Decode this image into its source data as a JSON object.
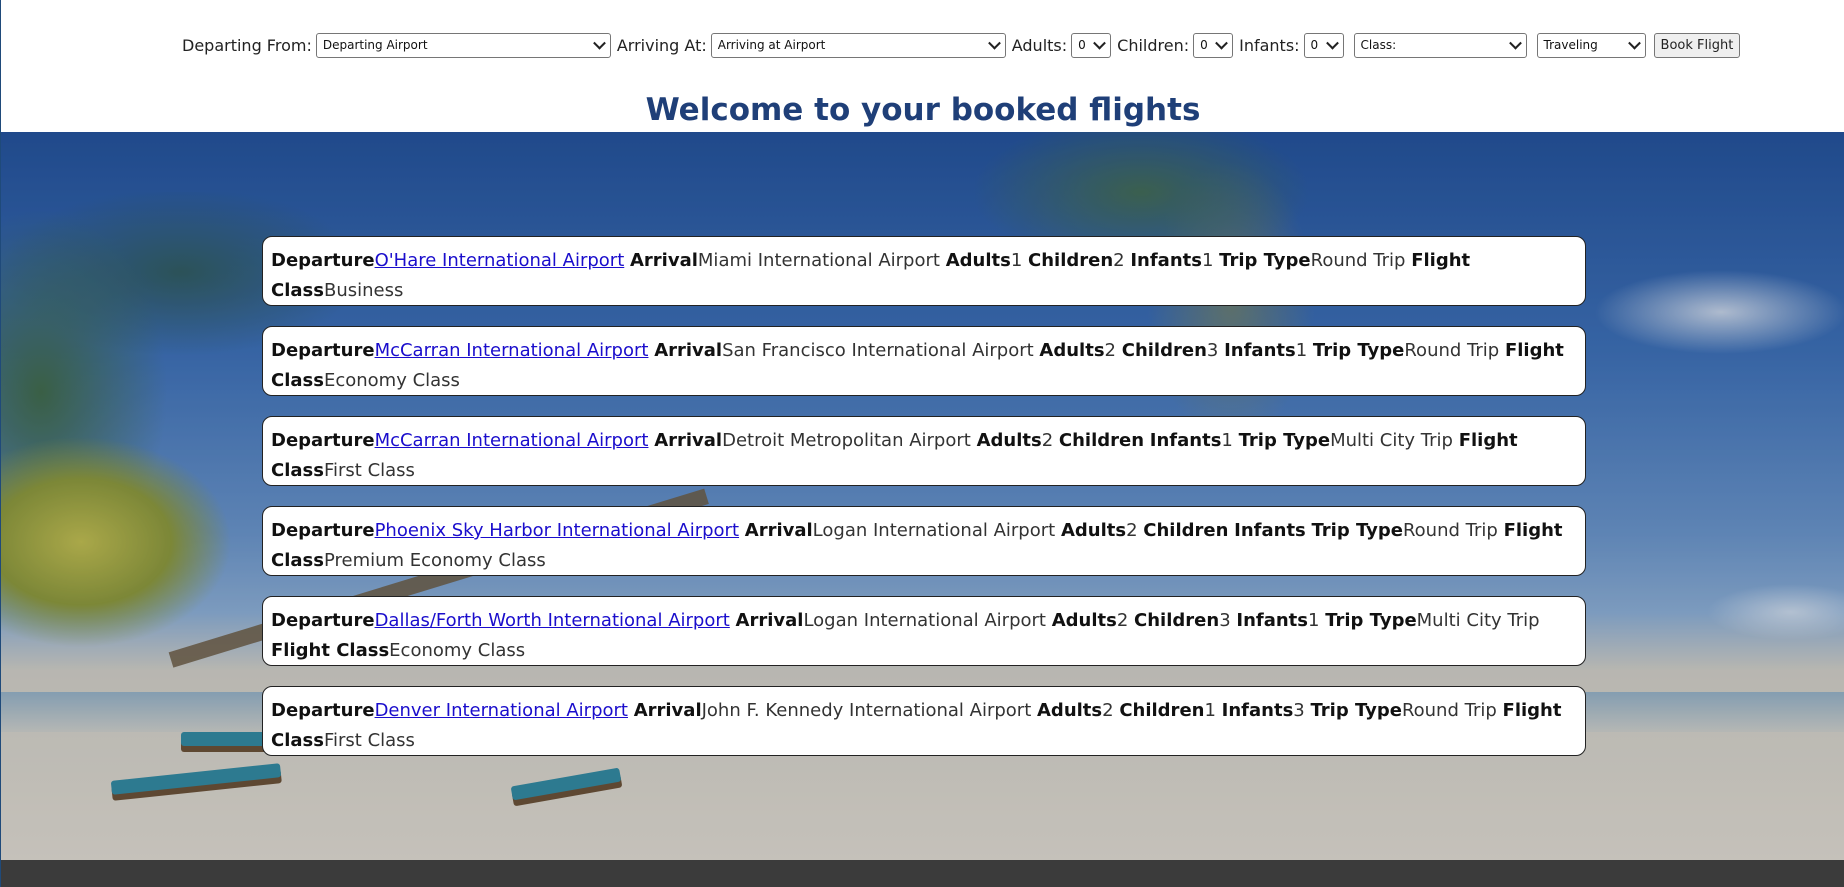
{
  "booking_bar": {
    "departing_label": "Departing From:",
    "departing_value": "Departing Airport",
    "arriving_label": "Arriving At:",
    "arriving_value": "Arriving at Airport",
    "adults_label": "Adults:",
    "adults_value": "0",
    "children_label": "Children:",
    "children_value": "0",
    "infants_label": "Infants:",
    "infants_value": "0",
    "class_value": "Class:",
    "traveling_value": "Traveling",
    "book_button": "Book Flight"
  },
  "page": {
    "heading": "Welcome to your booked flights"
  },
  "labels": {
    "departure": "Departure",
    "arrival": "Arrival",
    "adults": "Adults",
    "children": "Children",
    "infants": "Infants",
    "trip_type": "Trip Type",
    "flight_class": "Flight Class"
  },
  "flights": [
    {
      "departure": "O'Hare International Airport",
      "arrival": "Miami International Airport",
      "adults": "1",
      "children": "2",
      "infants": "1",
      "trip_type": "Round Trip",
      "flight_class": "Business"
    },
    {
      "departure": "McCarran International Airport",
      "arrival": "San Francisco International Airport",
      "adults": "2",
      "children": "3",
      "infants": "1",
      "trip_type": "Round Trip",
      "flight_class": "Economy Class"
    },
    {
      "departure": "McCarran International Airport",
      "arrival": "Detroit Metropolitan Airport",
      "adults": "2",
      "children": "",
      "infants": "1",
      "trip_type": "Multi City Trip",
      "flight_class": "First Class"
    },
    {
      "departure": "Phoenix Sky Harbor International Airport",
      "arrival": "Logan International Airport",
      "adults": "2",
      "children": "",
      "infants": "",
      "trip_type": "Round Trip",
      "flight_class": "Premium Economy Class"
    },
    {
      "departure": "Dallas/Forth Worth International Airport",
      "arrival": "Logan International Airport",
      "adults": "2",
      "children": "3",
      "infants": "1",
      "trip_type": "Multi City Trip",
      "flight_class": "Economy Class"
    },
    {
      "departure": "Denver International Airport",
      "arrival": "John F. Kennedy International Airport",
      "adults": "2",
      "children": "1",
      "infants": "3",
      "trip_type": "Round Trip",
      "flight_class": "First Class"
    }
  ],
  "colors": {
    "heading": "#1f3f78",
    "link": "#1a0dcc",
    "footer": "#3b3b3b"
  }
}
